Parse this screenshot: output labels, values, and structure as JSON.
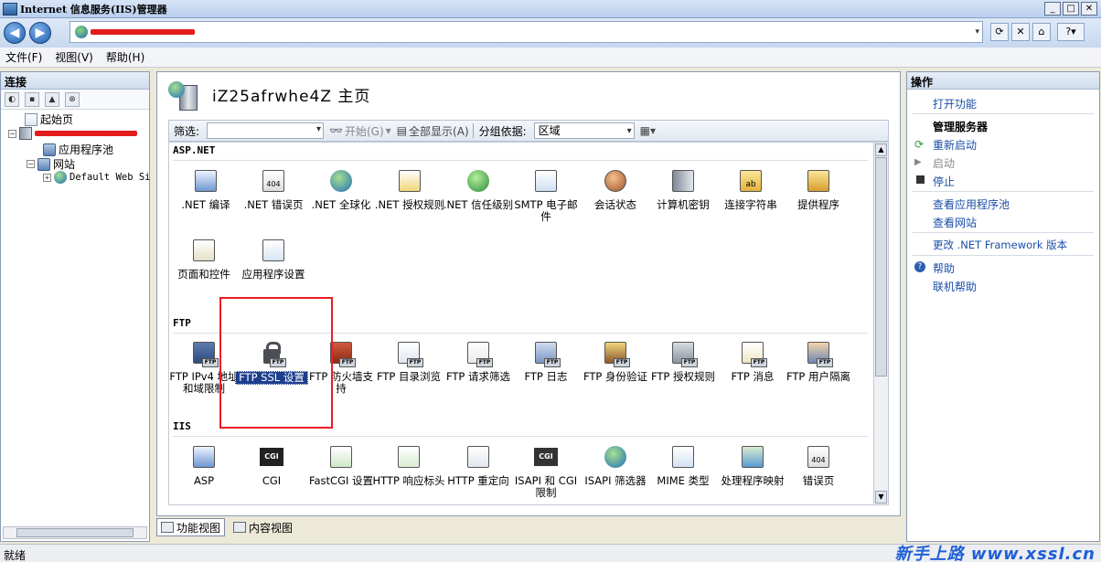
{
  "window": {
    "title": "Internet 信息服务(IIS)管理器"
  },
  "address": {
    "path": ""
  },
  "menu": {
    "file": "文件(F)",
    "view": "视图(V)",
    "help": "帮助(H)"
  },
  "connections": {
    "title": "连接",
    "tree": {
      "start_page": "起始页",
      "server": "",
      "app_pools": "应用程序池",
      "sites": "网站",
      "default_site": "Default Web Si"
    }
  },
  "main": {
    "title": "iZ25afrwhe4Z 主页",
    "filter_label": "筛选:",
    "start_label": "开始(G)",
    "show_all_label": "全部显示(A)",
    "group_by_label": "分组依据:",
    "group_by_value": "区域",
    "groups": [
      {
        "name": "ASP.NET",
        "features": [
          {
            "label": ".NET 编译",
            "icon": "dotnet-compile-icon"
          },
          {
            "label": ".NET 错误页",
            "icon": "dotnet-error-pages-icon"
          },
          {
            "label": ".NET 全球化",
            "icon": "dotnet-globalization-icon"
          },
          {
            "label": ".NET 授权规则",
            "icon": "dotnet-authorization-icon"
          },
          {
            "label": ".NET 信任级别",
            "icon": "dotnet-trust-icon"
          },
          {
            "label": "SMTP 电子邮件",
            "icon": "smtp-email-icon"
          },
          {
            "label": "会话状态",
            "icon": "session-state-icon"
          },
          {
            "label": "计算机密钥",
            "icon": "machine-key-icon"
          },
          {
            "label": "连接字符串",
            "icon": "connection-strings-icon"
          },
          {
            "label": "提供程序",
            "icon": "providers-icon"
          },
          {
            "label": "页面和控件",
            "icon": "pages-controls-icon"
          },
          {
            "label": "应用程序设置",
            "icon": "app-settings-icon"
          }
        ]
      },
      {
        "name": "FTP",
        "features": [
          {
            "label": "FTP IPv4 地址和域限制",
            "icon": "ftp-ip-restrictions-icon"
          },
          {
            "label": "FTP SSL 设置",
            "icon": "ftp-ssl-icon",
            "selected": true
          },
          {
            "label": "FTP 防火墙支持",
            "icon": "ftp-firewall-icon"
          },
          {
            "label": "FTP 目录浏览",
            "icon": "ftp-directory-browsing-icon"
          },
          {
            "label": "FTP 请求筛选",
            "icon": "ftp-request-filtering-icon"
          },
          {
            "label": "FTP 日志",
            "icon": "ftp-logging-icon"
          },
          {
            "label": "FTP 身份验证",
            "icon": "ftp-authentication-icon"
          },
          {
            "label": "FTP 授权规则",
            "icon": "ftp-authorization-icon"
          },
          {
            "label": "FTP 消息",
            "icon": "ftp-messages-icon"
          },
          {
            "label": "FTP 用户隔离",
            "icon": "ftp-user-isolation-icon"
          }
        ]
      },
      {
        "name": "IIS",
        "features": [
          {
            "label": "ASP",
            "icon": "asp-icon"
          },
          {
            "label": "CGI",
            "icon": "cgi-icon"
          },
          {
            "label": "FastCGI 设置",
            "icon": "fastcgi-icon"
          },
          {
            "label": "HTTP 响应标头",
            "icon": "http-response-headers-icon"
          },
          {
            "label": "HTTP 重定向",
            "icon": "http-redirect-icon"
          },
          {
            "label": "ISAPI 和 CGI 限制",
            "icon": "isapi-cgi-restrictions-icon"
          },
          {
            "label": "ISAPI 筛选器",
            "icon": "isapi-filters-icon"
          },
          {
            "label": "MIME 类型",
            "icon": "mime-types-icon"
          },
          {
            "label": "处理程序映射",
            "icon": "handler-mappings-icon"
          },
          {
            "label": "错误页",
            "icon": "error-pages-icon"
          }
        ]
      }
    ]
  },
  "views": {
    "features": "功能视图",
    "content": "内容视图"
  },
  "actions": {
    "title": "操作",
    "open_feature": "打开功能",
    "manage_server": "管理服务器",
    "restart": "重新启动",
    "start": "启动",
    "stop": "停止",
    "view_app_pools": "查看应用程序池",
    "view_sites": "查看网站",
    "change_framework": "更改 .NET Framework 版本",
    "help": "帮助",
    "online_help": "联机帮助"
  },
  "status": {
    "text": "就绪"
  },
  "watermark": "新手上路 www.xssl.cn",
  "colors": {
    "selection": "#1e3f8f",
    "highlight_box": "#ee1b24",
    "link": "#1a4ea8"
  }
}
